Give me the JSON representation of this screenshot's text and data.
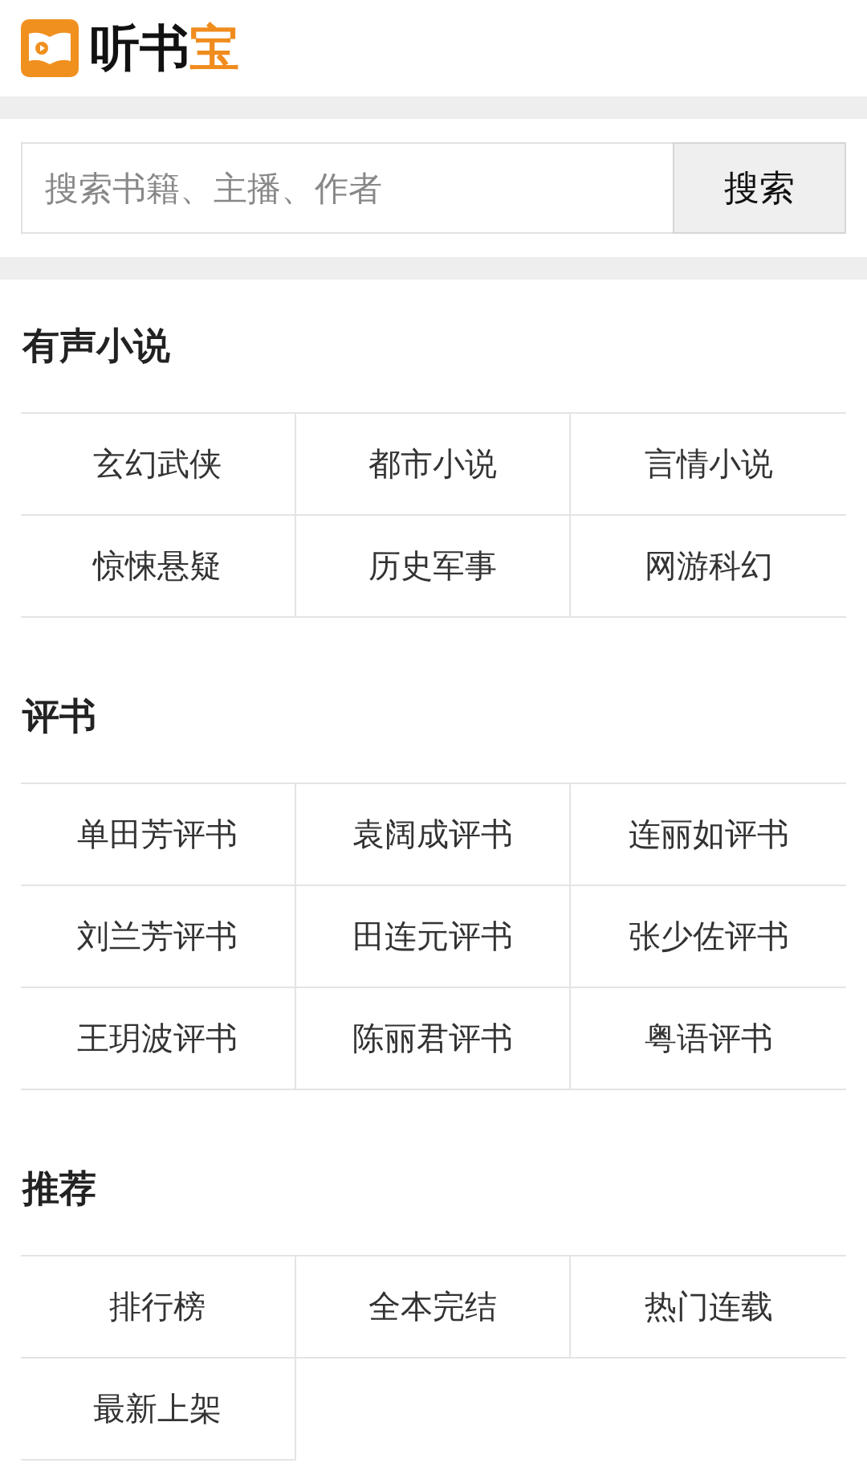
{
  "logo": {
    "text": "听书",
    "accent": "宝"
  },
  "search": {
    "placeholder": "搜索书籍、主播、作者",
    "button": "搜索"
  },
  "sections": [
    {
      "title": "有声小说",
      "items": [
        "玄幻武侠",
        "都市小说",
        "言情小说",
        "惊悚悬疑",
        "历史军事",
        "网游科幻"
      ]
    },
    {
      "title": "评书",
      "items": [
        "单田芳评书",
        "袁阔成评书",
        "连丽如评书",
        "刘兰芳评书",
        "田连元评书",
        "张少佐评书",
        "王玥波评书",
        "陈丽君评书",
        "粤语评书"
      ]
    },
    {
      "title": "推荐",
      "items": [
        "排行榜",
        "全本完结",
        "热门连载",
        "最新上架"
      ]
    }
  ]
}
